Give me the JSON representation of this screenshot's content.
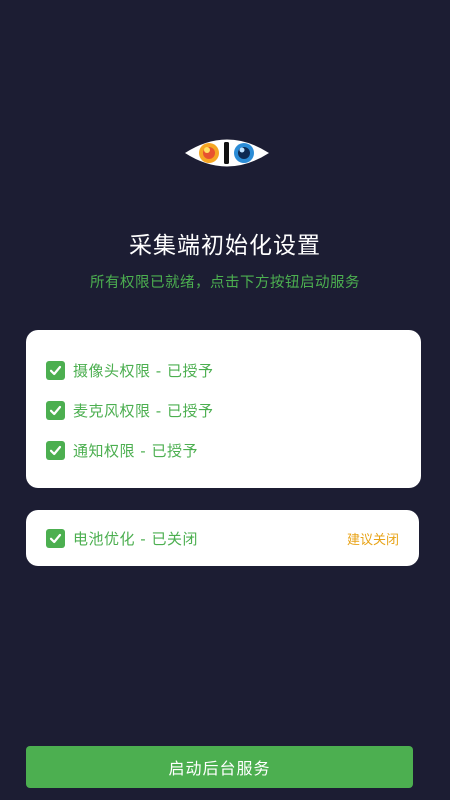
{
  "header": {
    "logo_icon": "eye-logo-icon",
    "title": "采集端初始化设置",
    "subtitle": "所有权限已就绪，点击下方按钮启动服务"
  },
  "permissions": [
    {
      "icon": "check-icon",
      "label": "摄像头权限 - 已授予"
    },
    {
      "icon": "check-icon",
      "label": "麦克风权限 - 已授予"
    },
    {
      "icon": "check-icon",
      "label": "通知权限 - 已授予"
    }
  ],
  "battery": {
    "icon": "check-icon",
    "label": "电池优化 - 已关闭",
    "action_label": "建议关闭"
  },
  "actions": {
    "start_label": "启动后台服务"
  },
  "colors": {
    "background": "#1c1d33",
    "accent_green": "#4caf50",
    "warning_orange": "#e8a317",
    "card": "#ffffff"
  }
}
